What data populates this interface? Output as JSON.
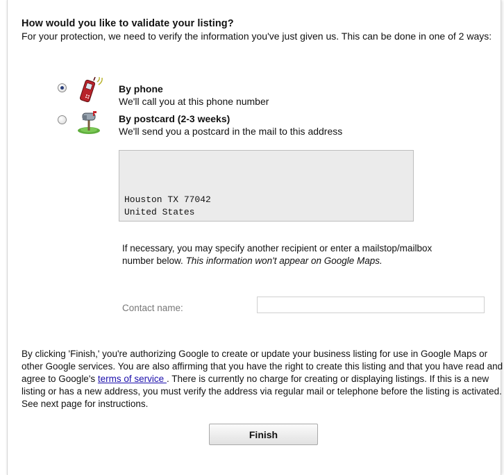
{
  "heading": "How would you like to validate your listing?",
  "intro": "For your protection, we need to verify the information you've just given us. This can be done in one of 2 ways:",
  "options": [
    {
      "title": "By phone",
      "description": "We'll call you at this phone number",
      "selected": true,
      "icon": "mobile-phone-icon"
    },
    {
      "title": "By postcard (2-3 weeks)",
      "description": "We'll send you a postcard in the mail to this address",
      "selected": false,
      "icon": "mailbox-icon"
    }
  ],
  "address": {
    "line1": "Houston TX 77042",
    "line2": "United States"
  },
  "note": {
    "text": "If necessary, you may specify another recipient or enter a mailstop/mailbox number below. ",
    "italic": "This information won't appear on Google Maps."
  },
  "contact": {
    "label": "Contact name:",
    "value": "",
    "placeholder": ""
  },
  "terms": {
    "before": "By clicking 'Finish,' you're authorizing Google to create or update your business listing for use in Google Maps or other Google services. You are also affirming that you have the right to create this listing and that you have read and agree to Google's ",
    "link": "terms of service ",
    "after": ". There is currently no charge for creating or displaying listings. If this is a new listing or has a new address, you must verify the address via regular mail or telephone before the listing is activated. See next page for instructions."
  },
  "finish_label": "Finish",
  "colors": {
    "link": "#1a0dab",
    "address_box": "#ebebeb",
    "radio_dot": "#2a3f7a"
  }
}
